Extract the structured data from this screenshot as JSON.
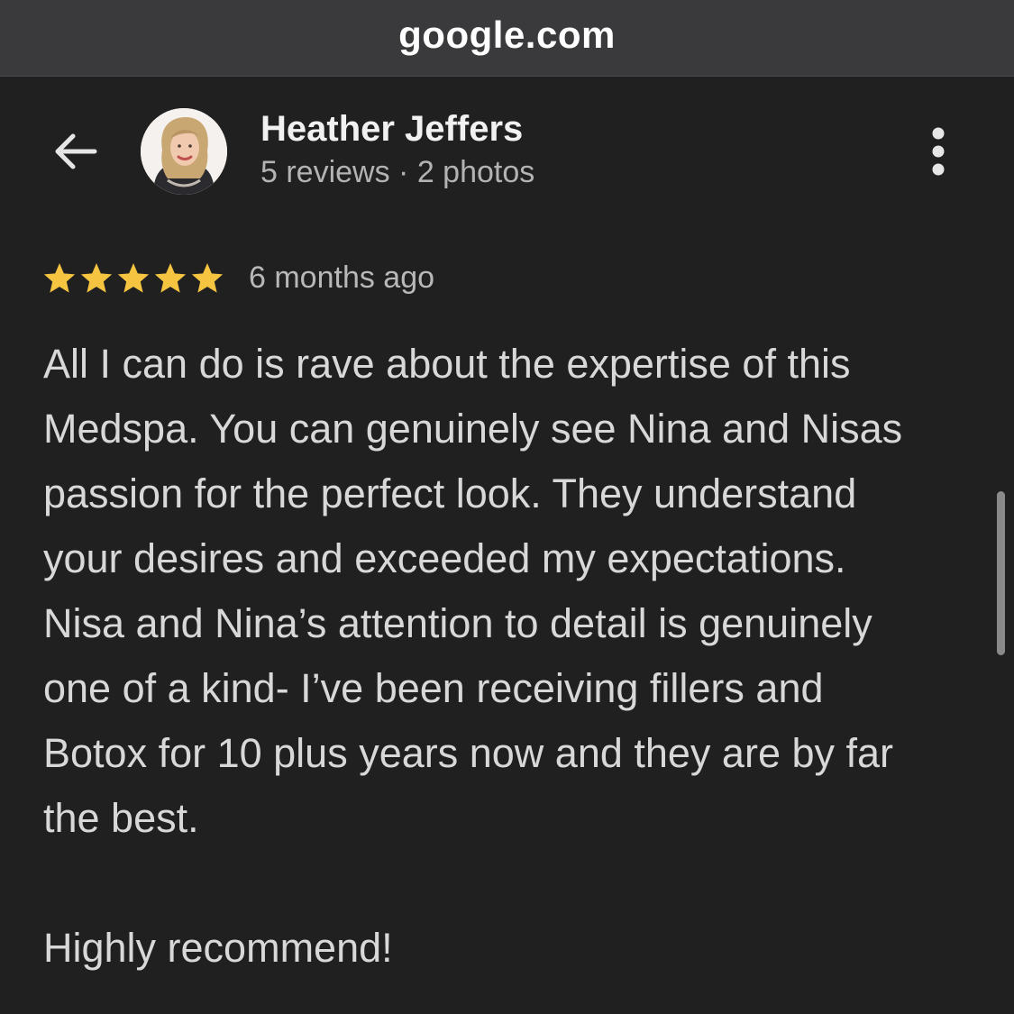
{
  "browser": {
    "url": "google.com"
  },
  "header": {
    "back_icon": "arrow-left-icon",
    "reviewer_name": "Heather Jeffers",
    "reviewer_meta": "5 reviews · 2 photos",
    "more_icon": "more-vertical-icon"
  },
  "rating": {
    "stars": 5,
    "max_stars": 5,
    "star_color": "#f5c542",
    "time_ago": "6 months ago"
  },
  "review": {
    "lines": [
      "All I can do is rave about the expertise of this",
      "Medspa. You can genuinely see Nina and Nisas",
      "passion for the perfect look. They understand",
      "your desires and exceeded my expectations.",
      "Nisa and Nina’s attention to detail is genuinely",
      "one of a kind- I’ve been receiving fillers and",
      "Botox for 10 plus years now and they are by far",
      "the best.",
      "",
      "Highly recommend!"
    ]
  },
  "colors": {
    "background": "#202020",
    "url_bar": "#3a3a3c",
    "text_primary": "#f1f1f1",
    "text_secondary": "#b3b3b3",
    "star": "#f5c542"
  }
}
